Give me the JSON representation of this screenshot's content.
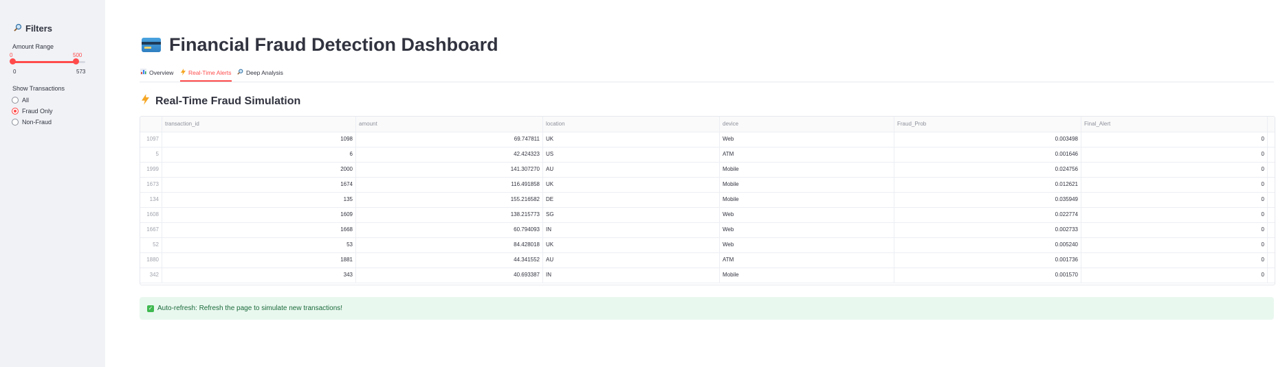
{
  "sidebar": {
    "title": "Filters",
    "title_icon": "magnifier-icon",
    "amount_range": {
      "label": "Amount Range",
      "min": "0",
      "max": "573",
      "low_value": "0",
      "high_value": "500",
      "low": 0,
      "high": 500,
      "range_max": 573
    },
    "show_transactions": {
      "label": "Show Transactions",
      "options": [
        "All",
        "Fraud Only",
        "Non-Fraud"
      ],
      "selected": "Fraud Only"
    }
  },
  "main": {
    "title": "Financial Fraud Detection Dashboard",
    "title_icon": "credit-card-icon",
    "tabs": [
      {
        "label": "Overview",
        "icon": "bar-chart-icon",
        "active": false
      },
      {
        "label": "Real-Time Alerts",
        "icon": "lightning-icon",
        "active": true
      },
      {
        "label": "Deep Analysis",
        "icon": "magnifier-icon",
        "active": false
      }
    ],
    "section_title": "Real-Time Fraud Simulation",
    "section_icon": "lightning-icon",
    "table": {
      "columns": [
        "transaction_id",
        "amount",
        "location",
        "device",
        "Fraud_Prob",
        "Final_Alert"
      ],
      "rows": [
        {
          "idx": "1097",
          "cells": [
            "1098",
            "69.747811",
            "UK",
            "Web",
            "0.003498",
            "0"
          ]
        },
        {
          "idx": "5",
          "cells": [
            "6",
            "42.424323",
            "US",
            "ATM",
            "0.001646",
            "0"
          ]
        },
        {
          "idx": "1999",
          "cells": [
            "2000",
            "141.307270",
            "AU",
            "Mobile",
            "0.024756",
            "0"
          ]
        },
        {
          "idx": "1673",
          "cells": [
            "1674",
            "116.491858",
            "UK",
            "Mobile",
            "0.012621",
            "0"
          ]
        },
        {
          "idx": "134",
          "cells": [
            "135",
            "155.216582",
            "DE",
            "Mobile",
            "0.035949",
            "0"
          ]
        },
        {
          "idx": "1608",
          "cells": [
            "1609",
            "138.215773",
            "SG",
            "Web",
            "0.022774",
            "0"
          ]
        },
        {
          "idx": "1667",
          "cells": [
            "1668",
            "60.794093",
            "IN",
            "Web",
            "0.002733",
            "0"
          ]
        },
        {
          "idx": "52",
          "cells": [
            "53",
            "84.428018",
            "UK",
            "Web",
            "0.005240",
            "0"
          ]
        },
        {
          "idx": "1880",
          "cells": [
            "1881",
            "44.341552",
            "AU",
            "ATM",
            "0.001736",
            "0"
          ]
        },
        {
          "idx": "342",
          "cells": [
            "343",
            "40.693387",
            "IN",
            "Mobile",
            "0.001570",
            "0"
          ]
        }
      ]
    },
    "alert": {
      "icon": "check-icon",
      "text": "Auto-refresh: Refresh the page to simulate new transactions!"
    }
  },
  "colors": {
    "accent": "#ff4b4b",
    "sidebar_bg": "#f0f2f6",
    "success_bg": "#e9f8ef",
    "success_text": "#1a6a3a"
  }
}
